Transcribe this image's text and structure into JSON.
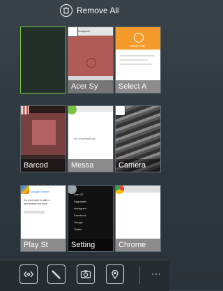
{
  "header": {
    "remove_all_label": "Remove All"
  },
  "cards": [
    {
      "label": ""
    },
    {
      "label": "Acer Sy",
      "mini_title": "Snapshot"
    },
    {
      "label": "Select A",
      "mini_title": "Google Play"
    },
    {
      "label": "Barcod"
    },
    {
      "label": "Messa",
      "mini_text": "No conversations"
    },
    {
      "label": "Camera"
    },
    {
      "label": "Play St",
      "mini_title": "Google Search",
      "mini_text": "Do you want to add a secondary account"
    },
    {
      "label": "Setting",
      "mini_items": [
        "Acer ID",
        "Aggregate",
        "Instagram",
        "Facebook",
        "Google",
        "Twitter"
      ]
    },
    {
      "label": "Chrome"
    }
  ],
  "dock": {
    "more_label": "⋯"
  }
}
